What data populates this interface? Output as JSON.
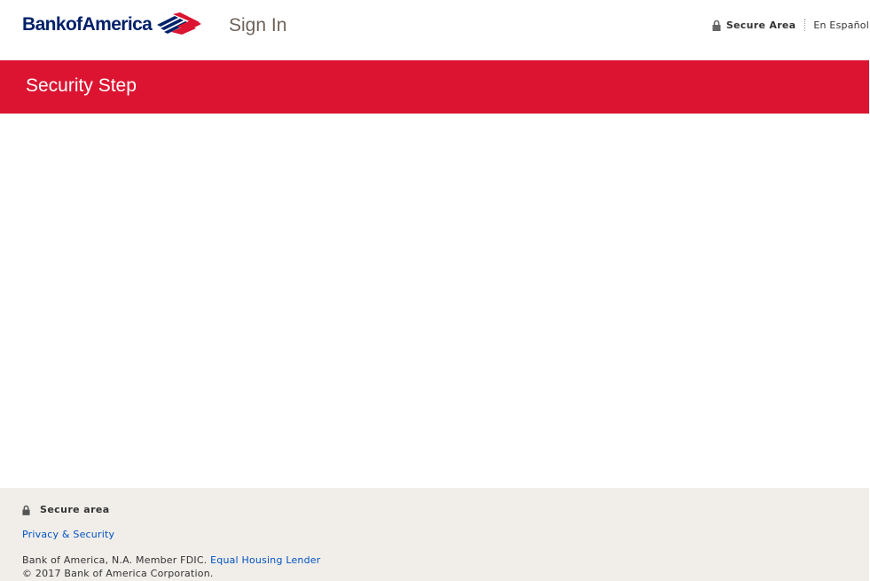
{
  "header": {
    "logo_text": "BankofAmerica",
    "page_title": "Sign In",
    "secure_area_label": "Secure Area",
    "language_link": "En Español"
  },
  "banner": {
    "title": "Security Step"
  },
  "footer": {
    "secure_label": "Secure area",
    "privacy_link": "Privacy & Security",
    "member_text": "Bank of America, N.A. Member FDIC.",
    "equal_housing_link": "Equal Housing Lender",
    "copyright": "© 2017 Bank of America Corporation."
  },
  "colors": {
    "brand_red": "#dc1431",
    "brand_blue": "#012169",
    "link_blue": "#0052c2",
    "footer_bg": "#f1eeea"
  },
  "icons": {
    "logo_mark": "flag-icon",
    "lock": "lock-icon"
  }
}
